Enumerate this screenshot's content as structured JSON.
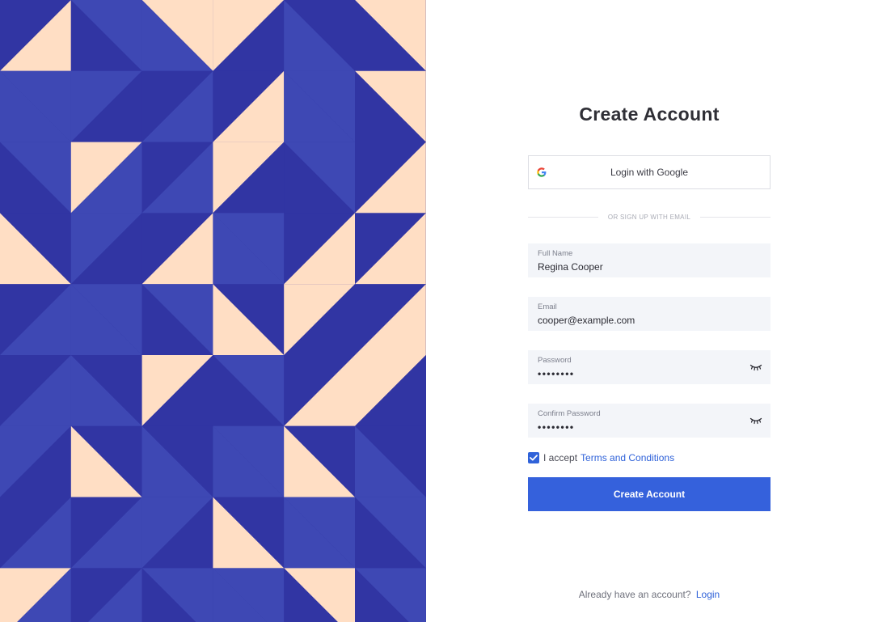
{
  "colors": {
    "art_dark": "#3135a3",
    "art_mid": "#3e48b4",
    "art_light": "#ffdec4",
    "accent": "#3561dc",
    "field_bg": "#f3f5f9"
  },
  "form": {
    "title": "Create Account",
    "google_button": {
      "label": "Login with Google",
      "icon": "google-icon"
    },
    "divider_text": "OR SIGN UP WITH EMAIL",
    "fields": {
      "full_name": {
        "label": "Full Name",
        "value": "Regina Cooper"
      },
      "email": {
        "label": "Email",
        "value": "cooper@example.com"
      },
      "password": {
        "label": "Password",
        "value": "••••••••",
        "icon": "eye-closed-icon"
      },
      "confirm_password": {
        "label": "Confirm Password",
        "value": "••••••••",
        "icon": "eye-closed-icon"
      }
    },
    "terms": {
      "checked": true,
      "prefix": "I accept",
      "link": "Terms and Conditions"
    },
    "submit_label": "Create Account"
  },
  "footer": {
    "prompt": "Already have an account?",
    "link": "Login"
  }
}
